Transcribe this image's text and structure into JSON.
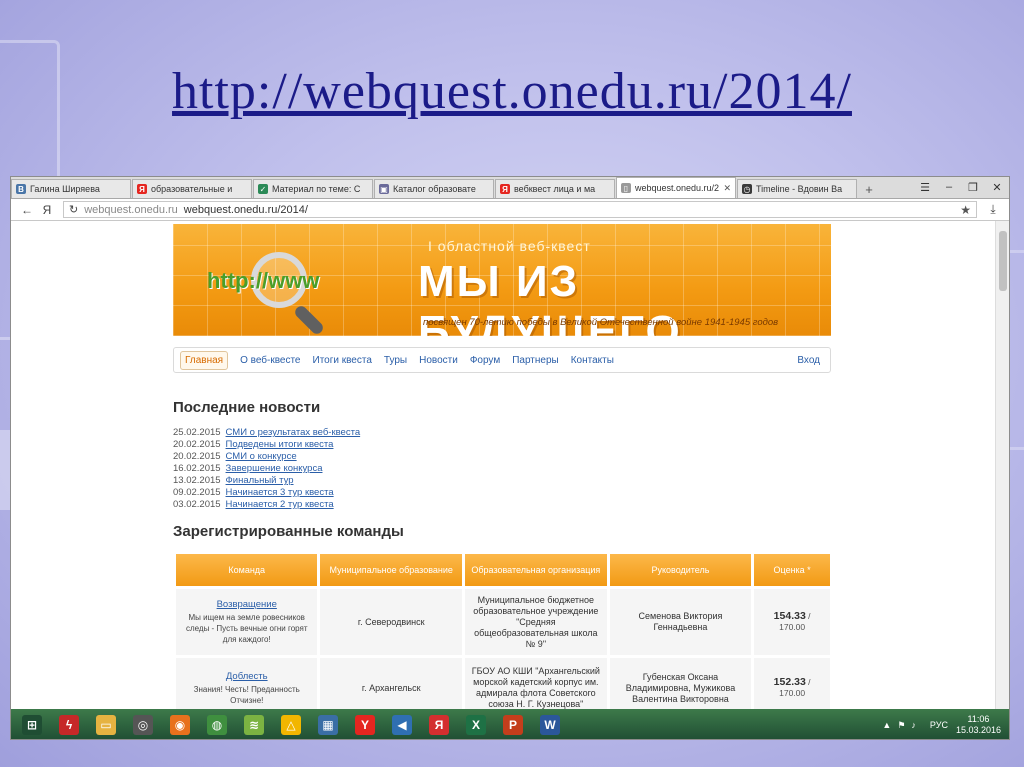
{
  "slide": {
    "title": "http://webquest.onedu.ru/2014/"
  },
  "browser": {
    "tabs": [
      {
        "label": "Галина Ширяева",
        "icon": "vk-icon",
        "color": "#4a76a8",
        "glyph": "В"
      },
      {
        "label": "образовательные и",
        "icon": "yandex-icon",
        "color": "#e52620",
        "glyph": "Я"
      },
      {
        "label": "Материал по теме: С",
        "icon": "check-icon",
        "color": "#2b8a57",
        "glyph": "✓"
      },
      {
        "label": "Каталог образовате",
        "icon": "catalog-icon",
        "color": "#6a6a9a",
        "glyph": "▣"
      },
      {
        "label": "вебквест лица и ма",
        "icon": "yandex-icon",
        "color": "#e52620",
        "glyph": "Я"
      },
      {
        "label": "webquest.onedu.ru/2",
        "icon": "page-icon",
        "color": "#9a9a9a",
        "glyph": "▯",
        "active": true
      },
      {
        "label": "Timeline - Вдовин Ва",
        "icon": "clock-icon",
        "color": "#3a3a3a",
        "glyph": "◷"
      }
    ],
    "address": {
      "host": "webquest.onedu.ru",
      "url": "webquest.onedu.ru/2014/"
    }
  },
  "site": {
    "banner": {
      "subtitle": "I областной веб-квест",
      "title": "МЫ ИЗ БУДУЩЕГО",
      "dedication": "посвящен 70-летию победы в Великой Отечественной войне 1941-1945 годов",
      "logo_text": "http://www"
    },
    "menu": [
      "Главная",
      "О веб-квесте",
      "Итоги квеста",
      "Туры",
      "Новости",
      "Форум",
      "Партнеры",
      "Контакты"
    ],
    "login": "Вход",
    "news_heading": "Последние новости",
    "news": [
      {
        "date": "25.02.2015",
        "title": "СМИ о результатах веб-квеста"
      },
      {
        "date": "20.02.2015",
        "title": "Подведены итоги квеста"
      },
      {
        "date": "20.02.2015",
        "title": "СМИ о конкурсе"
      },
      {
        "date": "16.02.2015",
        "title": "Завершение конкурса"
      },
      {
        "date": "13.02.2015",
        "title": "Финальный тур"
      },
      {
        "date": "09.02.2015",
        "title": "Начинается 3 тур квеста"
      },
      {
        "date": "03.02.2015",
        "title": "Начинается 2 тур квеста"
      }
    ],
    "teams_heading": "Зарегистрированные команды",
    "table": {
      "headers": [
        "Команда",
        "Муниципальное образование",
        "Образовательная организация",
        "Руководитель",
        "Оценка *"
      ],
      "rows": [
        {
          "team": "Возвращение",
          "motto": "Мы ищем на земле ровесников следы - Пусть вечные огни горят для каждого!",
          "municipality": "г. Северодвинск",
          "organization": "Муниципальное бюджетное образовательное учреждение \"Средняя общеобразовательная школа № 9\"",
          "leader": "Семенова Виктория Геннадьевна",
          "score": "154.33",
          "max": "170.00"
        },
        {
          "team": "Доблесть",
          "motto": "Знания! Честь! Преданность Отчизне!",
          "municipality": "г. Архангельск",
          "organization": "ГБОУ АО КШИ \"Архангельский морской кадетский корпус им. адмирала флота Советского союза Н. Г. Кузнецова\"",
          "leader": "Губенская Оксана Владимировна, Мужикова Валентина Викторовна",
          "score": "152.33",
          "max": "170.00"
        }
      ]
    }
  },
  "taskbar": {
    "apps": [
      {
        "icon": "windows-icon",
        "color": "#1f4d33",
        "glyph": "⊞"
      },
      {
        "icon": "flash-icon",
        "color": "#c62828",
        "glyph": "ϟ"
      },
      {
        "icon": "folder-icon",
        "color": "#e6b341",
        "glyph": "▭"
      },
      {
        "icon": "film-icon",
        "color": "#555555",
        "glyph": "◎"
      },
      {
        "icon": "firefox-icon",
        "color": "#e8711d",
        "glyph": "◉"
      },
      {
        "icon": "chrome-icon",
        "color": "#3f8f3f",
        "glyph": "◍"
      },
      {
        "icon": "wifi-icon",
        "color": "#7cb342",
        "glyph": "≋"
      },
      {
        "icon": "warning-icon",
        "color": "#f2b600",
        "glyph": "△"
      },
      {
        "icon": "calculator-icon",
        "color": "#3a6ea5",
        "glyph": "▦"
      },
      {
        "icon": "yandex-browser-icon",
        "color": "#e52620",
        "glyph": "Y"
      },
      {
        "icon": "speaker-icon",
        "color": "#2f6fb2",
        "glyph": "◀"
      },
      {
        "icon": "yandex-icon",
        "color": "#d32f2f",
        "glyph": "Я"
      },
      {
        "icon": "excel-icon",
        "color": "#1e7145",
        "glyph": "X"
      },
      {
        "icon": "powerpoint-icon",
        "color": "#c43e1c",
        "glyph": "P"
      },
      {
        "icon": "word-icon",
        "color": "#2b579a",
        "glyph": "W"
      }
    ],
    "lang": "РУС",
    "time": "11:06",
    "date": "15.03.2016"
  }
}
